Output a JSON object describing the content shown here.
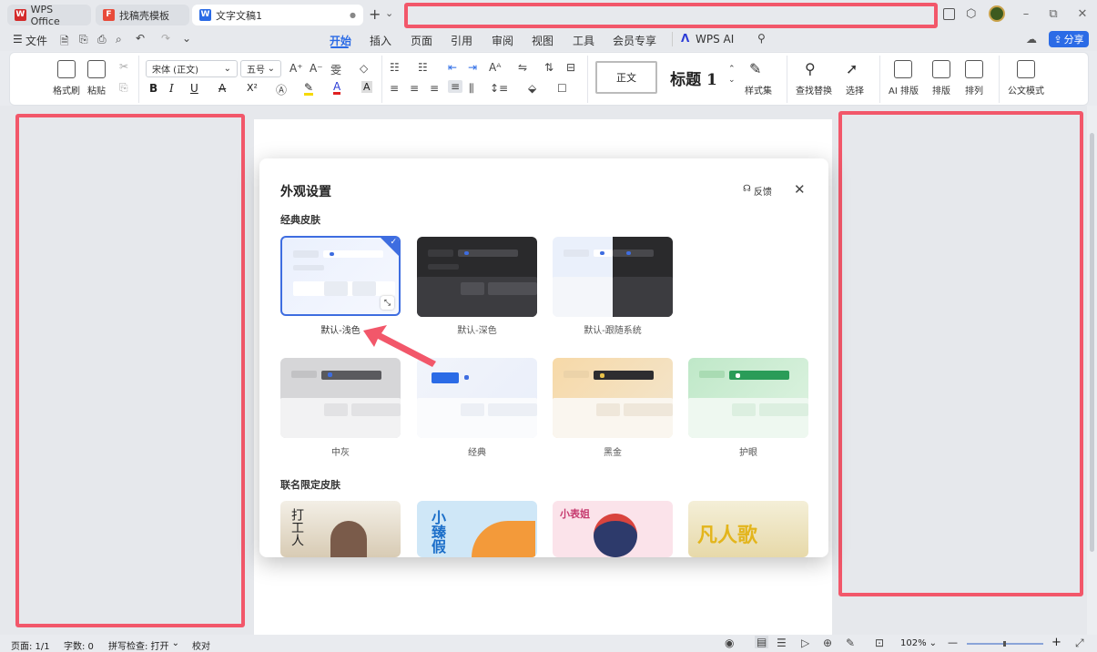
{
  "tabs": [
    {
      "label": "WPS Office",
      "logo": "W",
      "logo_color": "#d42b2b"
    },
    {
      "label": "找稿壳模板",
      "logo": "F",
      "logo_color": "#e84b3a"
    },
    {
      "label": "文字文稿1",
      "logo": "W",
      "logo_color": "#2b6be6",
      "close": "●"
    }
  ],
  "new_tab": "+",
  "tab_dropdown": "⌄",
  "window_controls": {
    "minimize": "–",
    "restore": "⧉",
    "close": "✕"
  },
  "menu": {
    "file": "文件",
    "items": [
      "开始",
      "插入",
      "页面",
      "引用",
      "审阅",
      "视图",
      "工具",
      "会员专享"
    ],
    "wps_ai": "WPS AI",
    "share": "分享"
  },
  "ribbon": {
    "format_painter": "格式刷",
    "paste": "粘贴",
    "font_name": "宋体 (正文)",
    "font_size": "五号",
    "style_normal": "正文",
    "style_heading": "标题 1",
    "style_set": "样式集",
    "find_replace": "查找替换",
    "select": "选择",
    "ai_layout": "AI 排版",
    "layout": "排版",
    "arrange": "排列",
    "official_mode": "公文模式",
    "bold": "B",
    "italic": "I",
    "underline": "U",
    "strike": "A",
    "superscript": "X²",
    "font_color": "A",
    "char_shading": "A"
  },
  "dialog": {
    "title": "外观设置",
    "feedback": "反馈",
    "section_classic": "经典皮肤",
    "section_collab": "联名限定皮肤",
    "classic_skins": [
      {
        "label": "默认-浅色",
        "selected": true
      },
      {
        "label": "默认-深色"
      },
      {
        "label": "默认-跟随系统"
      },
      {
        "label": "中灰"
      },
      {
        "label": "经典"
      },
      {
        "label": "黑金"
      },
      {
        "label": "护眼"
      }
    ],
    "collab_skins": [
      "打工人",
      "小臻假",
      "小表姐",
      "凡人歌"
    ]
  },
  "status": {
    "page": "页面: 1/1",
    "words": "字数: 0",
    "spell_check": "拼写检查: 打开",
    "proofread": "校对",
    "zoom": "102%",
    "zoom_out": "—",
    "zoom_in": "+"
  },
  "colors": {
    "accent": "#2b6be6",
    "annotation_red": "#f2576a"
  }
}
